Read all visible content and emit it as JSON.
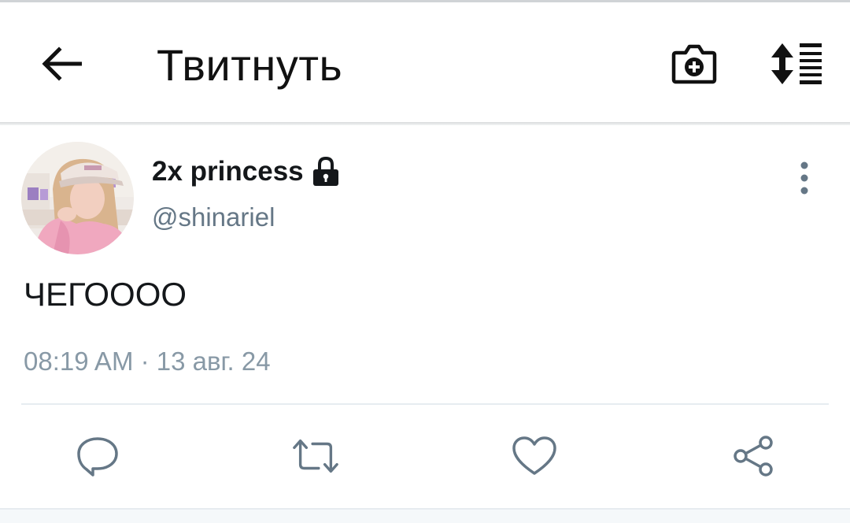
{
  "toolbar": {
    "title": "Твитнуть",
    "icons": [
      "back-arrow-icon",
      "camera-plus-icon",
      "sort-icon"
    ]
  },
  "tweet": {
    "display_name": "2x princess",
    "handle": "@shinariel",
    "protected": true,
    "text": "ЧЕГОООО",
    "timestamp": "08:19 AM · 13 авг. 24",
    "avatar": "avatar-photo"
  },
  "actions": [
    "reply-icon",
    "retweet-icon",
    "like-icon",
    "share-icon"
  ],
  "colors": {
    "primary_text": "#14171a",
    "secondary_text": "#657786",
    "meta_text": "#8899a6",
    "icon": "#657786",
    "divider": "#e6ecf0"
  }
}
